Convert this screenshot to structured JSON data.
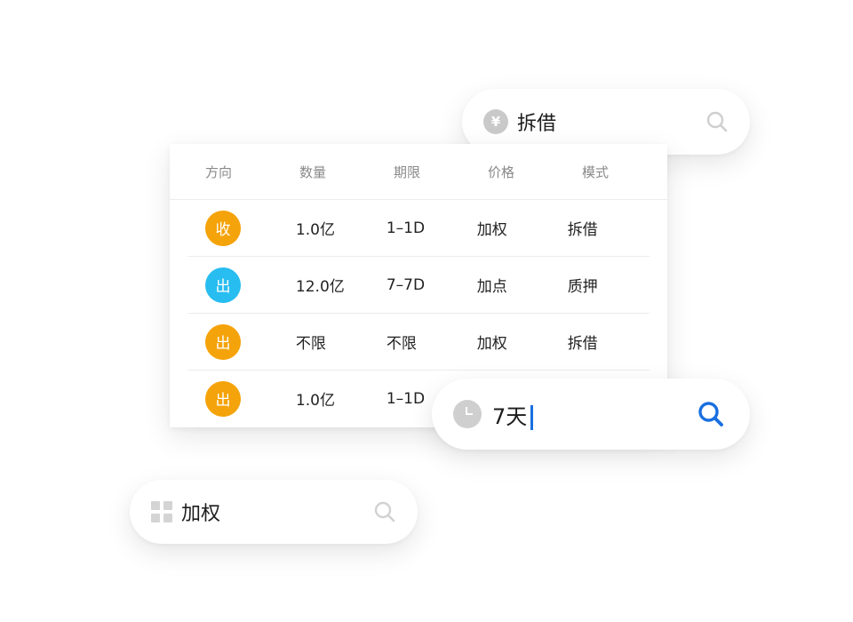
{
  "search_top": {
    "text": "拆借",
    "icon": "yuan-coin-icon"
  },
  "search_mid": {
    "text": "7天",
    "icon": "clock-icon"
  },
  "search_bottom": {
    "text": "加权",
    "icon": "grid-icon"
  },
  "table": {
    "headers": [
      "方向",
      "数量",
      "期限",
      "价格",
      "模式"
    ],
    "rows": [
      {
        "direction": "收",
        "color": "#f5a30a",
        "amount": "1.0亿",
        "term": "1–1D",
        "price": "加权",
        "mode": "拆借"
      },
      {
        "direction": "出",
        "color": "#27bdf0",
        "amount": "12.0亿",
        "term": "7–7D",
        "price": "加点",
        "mode": "质押"
      },
      {
        "direction": "出",
        "color": "#f5a30a",
        "amount": "不限",
        "term": "不限",
        "price": "加权",
        "mode": "拆借"
      },
      {
        "direction": "出",
        "color": "#f5a30a",
        "amount": "1.0亿",
        "term": "1–1D",
        "price": "",
        "mode": ""
      }
    ]
  },
  "colors": {
    "accent": "#1a6fe0",
    "gold": "#f5a30a",
    "sky": "#27bdf0"
  }
}
